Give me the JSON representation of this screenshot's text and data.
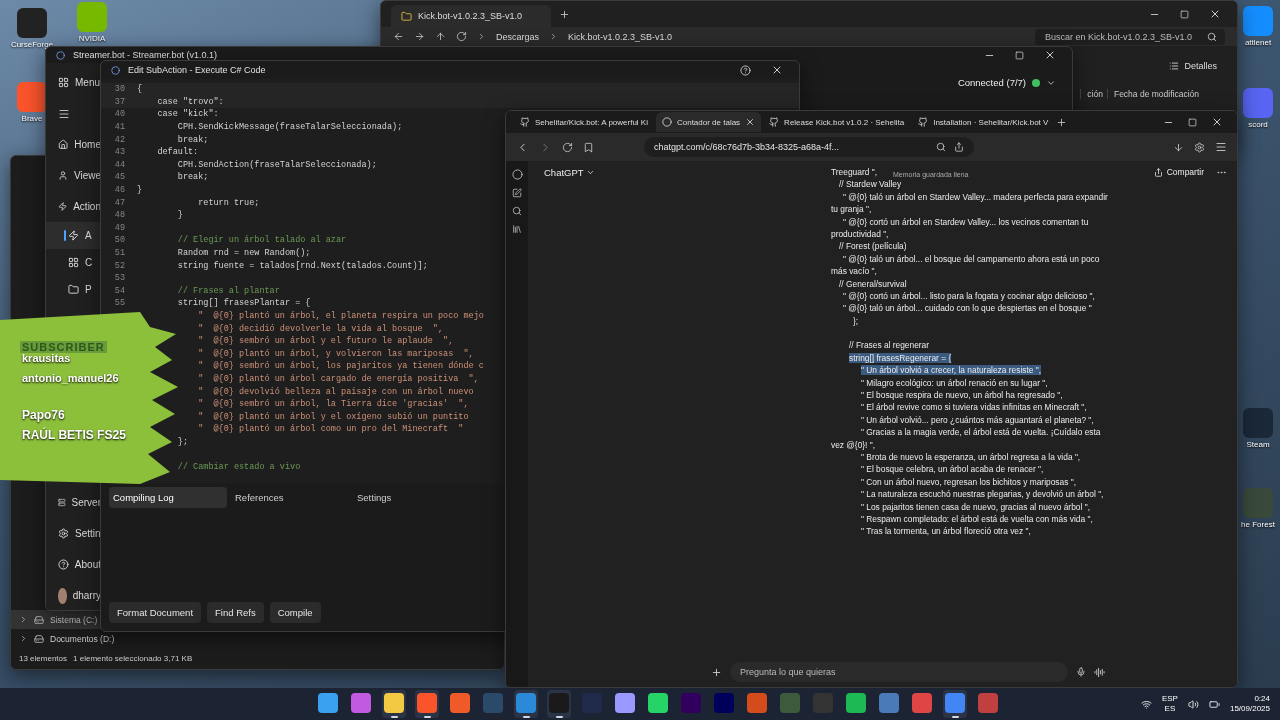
{
  "desktop_icons": [
    {
      "label": "CurseForge",
      "color": "#222222"
    },
    {
      "label": "NVIDIA",
      "color": "#76b900"
    },
    {
      "label": "Brave",
      "color": "#fb542b"
    },
    {
      "label": "attlenet",
      "color": "#148eff"
    },
    {
      "label": "scord",
      "color": "#5865f2"
    },
    {
      "label": "Steam",
      "color": "#1b2838"
    },
    {
      "label": "he Forest",
      "color": "#3a4a3a"
    }
  ],
  "explorer_back": {
    "tab": "Kick.bot-v1.0.2.3_SB-v1.0",
    "breadcrumb": [
      "Descargas",
      "Kick.bot-v1.0.2.3_SB-v1.0"
    ],
    "search_placeholder": "Buscar en Kick.bot-v1.0.2.3_SB-v1.0",
    "view_button": "Detalles",
    "column_headers": [
      "ción",
      "Fecha de modificación"
    ]
  },
  "explorer_front": {
    "drives": [
      {
        "label": "Sistema (C:)",
        "selected": true
      },
      {
        "label": "Documentos (D:)",
        "selected": false
      }
    ],
    "status": [
      "13 elementos",
      "1 elemento seleccionado  3,71 KB"
    ]
  },
  "streamerbot": {
    "title": "Streamer.bot - Streamer.bot (v1.0.1)",
    "connection": "Connected (7/7)",
    "connected": true,
    "menu_label": "Menu",
    "nav": [
      {
        "label": "Home",
        "kind": "item",
        "selected": false
      },
      {
        "label": "Viewe",
        "kind": "item",
        "selected": false
      },
      {
        "label": "Action",
        "kind": "item",
        "selected": false
      },
      {
        "label": "A",
        "kind": "sub",
        "selected": true
      },
      {
        "label": "C",
        "kind": "sub",
        "selected": false
      },
      {
        "label": "P",
        "kind": "sub",
        "selected": false
      },
      {
        "kind": "gap"
      },
      {
        "label": "Server",
        "kind": "item",
        "selected": false
      },
      {
        "label": "Settin",
        "kind": "item",
        "selected": false
      },
      {
        "label": "About",
        "kind": "item",
        "selected": false
      }
    ],
    "user": "dharry"
  },
  "editor": {
    "title": "Edit SubAction - Execute C# Code",
    "lines": [
      {
        "number": "30",
        "text": "{",
        "kind": "code"
      },
      {
        "number": "37",
        "text": "    case \"trovo\":",
        "kind": "code"
      },
      {
        "number": "40",
        "text": "    case \"kick\":",
        "kind": "code"
      },
      {
        "number": "41",
        "text": "        CPH.SendKickMessage(fraseTalarSeleccionada);",
        "kind": "code"
      },
      {
        "number": "42",
        "text": "        break;",
        "kind": "code"
      },
      {
        "number": "43",
        "text": "    default:",
        "kind": "code"
      },
      {
        "number": "44",
        "text": "        CPH.SendAction(fraseTalarSeleccionada);",
        "kind": "code"
      },
      {
        "number": "45",
        "text": "        break;",
        "kind": "code"
      },
      {
        "number": "46",
        "text": "}",
        "kind": "code"
      },
      {
        "number": "47",
        "text": "            return true;",
        "kind": "code"
      },
      {
        "number": "48",
        "text": "        }",
        "kind": "code"
      },
      {
        "number": "49",
        "kind": "blank"
      },
      {
        "number": "50",
        "text": "        // Elegir un árbol talado al azar",
        "kind": "comment"
      },
      {
        "number": "51",
        "text": "        Random rnd = new Random();",
        "kind": "code"
      },
      {
        "number": "52",
        "text": "        string fuente = talados[rnd.Next(talados.Count)];",
        "kind": "code"
      },
      {
        "number": "53",
        "kind": "blank"
      },
      {
        "number": "54",
        "text": "        // Frases al plantar",
        "kind": "comment"
      },
      {
        "number": "55",
        "text": "        string[] frasesPlantar = {",
        "kind": "code"
      },
      {
        "text": "            \"  @{0} plantó un árbol, el planeta respira un poco mejo",
        "kind": "string"
      },
      {
        "text": "            \"  @{0} decidió devolverle la vida al bosque  \",",
        "kind": "string"
      },
      {
        "text": "            \"  @{0} sembró un árbol y el futuro le aplaude  \",",
        "kind": "string"
      },
      {
        "text": "            \"  @{0} plantó un árbol, y volvieron las mariposas  \",",
        "kind": "string"
      },
      {
        "text": "            \"  @{0} sembró un árbol, los pajaritos ya tienen dónde c",
        "kind": "string"
      },
      {
        "text": "            \"  @{0} plantó un árbol cargado de energía positiva  \",",
        "kind": "string"
      },
      {
        "text": "            \"  @{0} devolvió belleza al paisaje con un árbol nuevo",
        "kind": "string"
      },
      {
        "text": "            \"  @{0} sembró un árbol, la Tierra dice 'gracias'  \",",
        "kind": "string"
      },
      {
        "text": "            \"  @{0} plantó un árbol y el oxígeno subió un puntito",
        "kind": "string"
      },
      {
        "text": "            \"  @{0} plantó un árbol como un pro del Minecraft  \"",
        "kind": "string"
      },
      {
        "text": "        };",
        "kind": "code"
      },
      {
        "kind": "blank"
      },
      {
        "text": "        // Cambiar estado a vivo",
        "kind": "comment"
      }
    ],
    "tabs": [
      {
        "label": "Compiling Log",
        "selected": true
      },
      {
        "label": "References",
        "selected": false
      },
      {
        "label": "Settings",
        "selected": false
      }
    ],
    "buttons": [
      "Format Document",
      "Find Refs",
      "Compile"
    ]
  },
  "browser": {
    "tabs": [
      {
        "title": "Sehelitar/Kick.bot: A powerful Ki",
        "selected": false,
        "kind": "github"
      },
      {
        "title": "Contador de talas",
        "selected": true,
        "kind": "chatgpt"
      },
      {
        "title": "Release Kick.bot v1.0.2 · Sehelita",
        "selected": false,
        "kind": "github"
      },
      {
        "title": "Installation · Sehelitar/Kick.bot V",
        "selected": false,
        "kind": "github"
      }
    ],
    "url": "chatgpt.com/c/68c76d7b-3b34-8325-a68a-4f...",
    "app_name": "ChatGPT",
    "share": "Compartir",
    "notice": "Memoria guardada llena",
    "messages": [
      {
        "text": "Treeguard  \",",
        "kind": "tail",
        "highlighted": false
      },
      {
        "text": "// Stardew Valley",
        "kind": "group",
        "highlighted": false
      },
      {
        "text": "\"  @{0} taló un árbol en Stardew Valley... madera perfecta para expandir tu granja  \",",
        "kind": "entry",
        "highlighted": false
      },
      {
        "text": "\"  @{0} cortó un árbol en Stardew Valley... los vecinos comentan tu productividad  \",",
        "kind": "entry",
        "highlighted": false
      },
      {
        "text": "// Forest (película)",
        "kind": "group",
        "highlighted": false
      },
      {
        "text": "\"  @{0} taló un árbol... el bosque del campamento ahora está un poco más vacío  \",",
        "kind": "entry",
        "highlighted": false
      },
      {
        "text": "// General/survival",
        "kind": "group",
        "highlighted": false
      },
      {
        "text": "\"  @{0} cortó un árbol... listo para la fogata y cocinar algo delicioso  \",",
        "kind": "entry",
        "highlighted": false
      },
      {
        "text": "\"  @{0} taló un árbol... cuidado con lo que despiertas en el bosque  \"",
        "kind": "entry",
        "highlighted": false
      },
      {
        "text": "};",
        "kind": "close",
        "highlighted": false
      },
      {
        "text": "// Frases al regenerar",
        "kind": "section",
        "highlighted": false
      },
      {
        "text": "string[] frasesRegenerar = {",
        "kind": "section",
        "highlighted": true
      },
      {
        "text": "\"  Un árbol volvió a crecer, la naturaleza resiste  \",",
        "kind": "item",
        "highlighted": true
      },
      {
        "text": "\"  Milagro ecológico: un árbol renació en su lugar  \",",
        "kind": "item",
        "highlighted": false
      },
      {
        "text": "\"  El bosque respira de nuevo, un árbol ha regresado  \",",
        "kind": "item",
        "highlighted": false
      },
      {
        "text": "\"  El árbol revive como si tuviera vidas infinitas en Minecraft  \",",
        "kind": "item",
        "highlighted": false
      },
      {
        "text": "\"  Un árbol volvió... pero ¿cuántos más aguantará el planeta?  \",",
        "kind": "item",
        "highlighted": false
      },
      {
        "text": "\"  Gracias a la magia verde, el árbol está de vuelta. ¡Cuídalo esta vez @{0}! \",",
        "kind": "item",
        "highlighted": false
      },
      {
        "text": "\"  Brota de nuevo la esperanza, un árbol regresa a la vida  \",",
        "kind": "item",
        "highlighted": false
      },
      {
        "text": "\"  El bosque celebra, un árbol acaba de renacer  \",",
        "kind": "item",
        "highlighted": false
      },
      {
        "text": "\"  Con un árbol nuevo, regresan los bichitos y mariposas  \",",
        "kind": "item",
        "highlighted": false
      },
      {
        "text": "\"  La naturaleza escuchó nuestras plegarias, y devolvió un árbol  \",",
        "kind": "item",
        "highlighted": false
      },
      {
        "text": "\"  Los pajaritos tienen casa de nuevo, gracias al nuevo árbol  \",",
        "kind": "item",
        "highlighted": false
      },
      {
        "text": "\"  Respawn completado: el árbol está de vuelta con más vida  \",",
        "kind": "item",
        "highlighted": false
      },
      {
        "text": "\"  Tras la tormenta, un árbol floreció otra vez  \",",
        "kind": "item",
        "highlighted": false
      }
    ],
    "composer_placeholder": "Pregunta lo que quieras"
  },
  "overlay": {
    "title": "SUBSCRIBER",
    "names": [
      {
        "name": "krausitas",
        "kind": "subscriber"
      },
      {
        "name": "antonio_manuel26",
        "kind": "subscriber"
      },
      {
        "name": "Papo76",
        "kind": "follower"
      },
      {
        "name": "RAÚL BETIS FS25",
        "kind": "follower"
      }
    ]
  },
  "taskbar": {
    "apps": [
      {
        "color": "#3aa0f0",
        "running": false
      },
      {
        "color": "#c05be0",
        "running": false
      },
      {
        "color": "#f3c842",
        "running": true
      },
      {
        "color": "#fb542b",
        "running": true
      },
      {
        "color": "#f05a28",
        "running": false
      },
      {
        "color": "#2b4a6a",
        "running": false
      },
      {
        "color": "#2b8ad8",
        "running": true
      },
      {
        "color": "#1a1a1a",
        "running": true
      },
      {
        "color": "#1f2a4a",
        "running": false
      },
      {
        "color": "#9999ff",
        "running": false
      },
      {
        "color": "#25d366",
        "running": false
      },
      {
        "color": "#31005f",
        "running": false
      },
      {
        "color": "#00005b",
        "running": false
      },
      {
        "color": "#d44c1c",
        "running": false
      },
      {
        "color": "#3d5a3d",
        "running": false
      },
      {
        "color": "#333333",
        "running": false
      },
      {
        "color": "#1db954",
        "running": false
      },
      {
        "color": "#4a7ab8",
        "running": false
      },
      {
        "color": "#e04545",
        "running": false
      },
      {
        "color": "#4285f4",
        "running": true
      },
      {
        "color": "#c04040",
        "running": false
      }
    ],
    "language": [
      "ESP",
      "ES"
    ],
    "time": "0:24",
    "date": "15/09/2025"
  }
}
